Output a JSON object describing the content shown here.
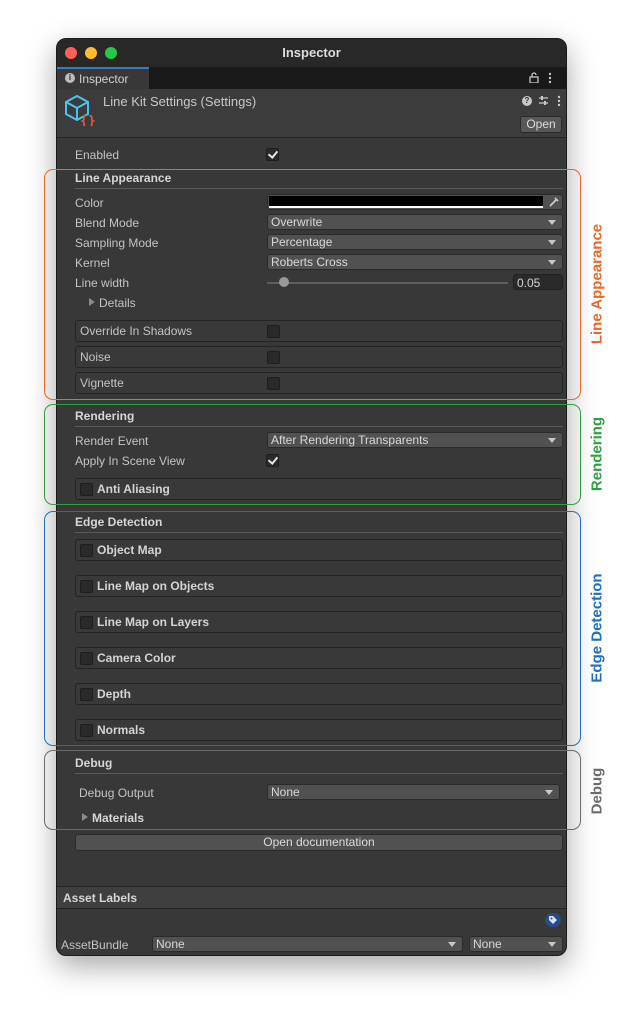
{
  "window": {
    "title": "Inspector",
    "traffic_lights": {
      "close": "#ff5f57",
      "minimize": "#febc2e",
      "zoom": "#28c840"
    }
  },
  "tab": {
    "label": "Inspector",
    "icon": "info-icon"
  },
  "asset": {
    "name": "Line Kit Settings (Settings)",
    "open_label": "Open",
    "icon": "scriptable-object-icon"
  },
  "fields": {
    "enabled": {
      "label": "Enabled",
      "checked": true
    }
  },
  "line_appearance": {
    "header": "Line Appearance",
    "color": {
      "label": "Color",
      "value": "#000000"
    },
    "blend_mode": {
      "label": "Blend Mode",
      "value": "Overwrite"
    },
    "sampling_mode": {
      "label": "Sampling Mode",
      "value": "Percentage"
    },
    "kernel": {
      "label": "Kernel",
      "value": "Roberts Cross"
    },
    "line_width": {
      "label": "Line width",
      "value": "0.05"
    },
    "details": {
      "label": "Details"
    },
    "override_in_shadows": {
      "label": "Override In Shadows",
      "checked": false
    },
    "noise": {
      "label": "Noise",
      "checked": false
    },
    "vignette": {
      "label": "Vignette",
      "checked": false
    }
  },
  "rendering": {
    "header": "Rendering",
    "render_event": {
      "label": "Render Event",
      "value": "After Rendering Transparents"
    },
    "apply_in_scene_view": {
      "label": "Apply In Scene View",
      "checked": true
    },
    "anti_aliasing": {
      "label": "Anti Aliasing",
      "checked": false
    }
  },
  "edge_detection": {
    "header": "Edge Detection",
    "items": [
      {
        "label": "Object Map",
        "checked": false
      },
      {
        "label": "Line Map on Objects",
        "checked": false
      },
      {
        "label": "Line Map on Layers",
        "checked": false
      },
      {
        "label": "Camera Color",
        "checked": false
      },
      {
        "label": "Depth",
        "checked": false
      },
      {
        "label": "Normals",
        "checked": false
      }
    ]
  },
  "debug": {
    "header": "Debug",
    "debug_output": {
      "label": "Debug Output",
      "value": "None"
    },
    "materials": {
      "label": "Materials"
    }
  },
  "open_documentation": "Open documentation",
  "asset_labels": {
    "header": "Asset Labels",
    "assetbundle_label": "AssetBundle",
    "bundle_value": "None",
    "variant_value": "None"
  },
  "annotations": {
    "line_appearance": {
      "label": "Line Appearance",
      "color": "#e8692a"
    },
    "rendering": {
      "label": "Rendering",
      "color": "#2ea043"
    },
    "edge_detection": {
      "label": "Edge Detection",
      "color": "#1f6fbf"
    },
    "debug": {
      "label": "Debug",
      "color": "#6b6b6b"
    }
  }
}
